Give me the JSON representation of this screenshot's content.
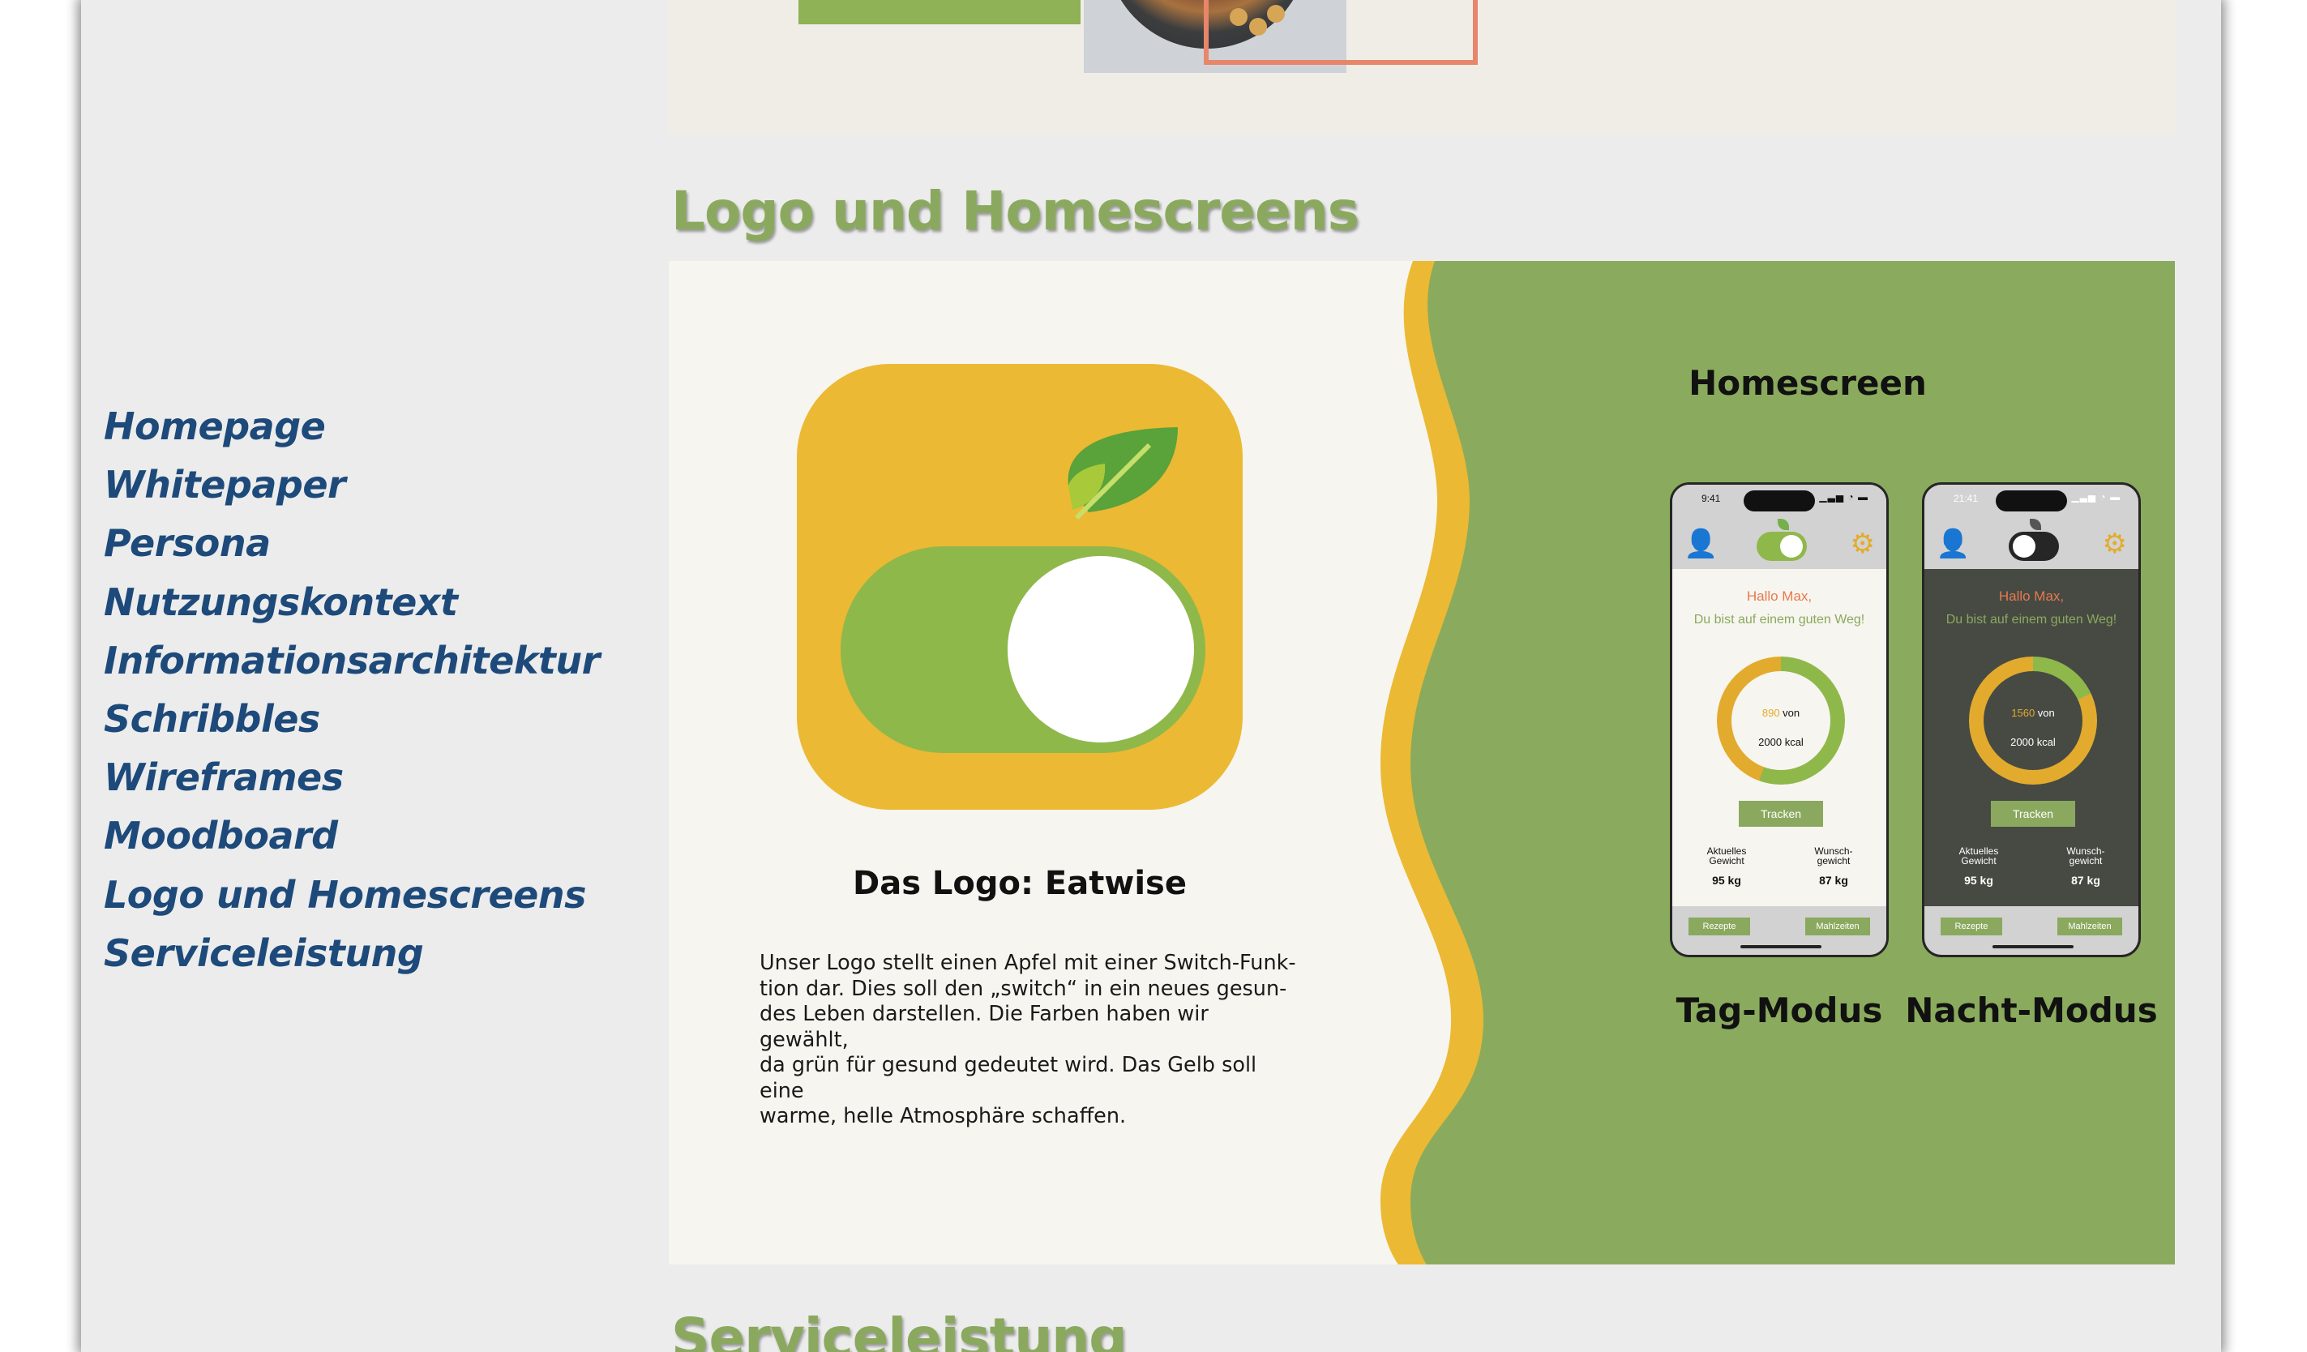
{
  "nav": {
    "items": [
      {
        "label": "Homepage"
      },
      {
        "label": "Whitepaper"
      },
      {
        "label": "Persona"
      },
      {
        "label": "Nutzungskontext"
      },
      {
        "label": "Informationsarchitektur"
      },
      {
        "label": "Schribbles"
      },
      {
        "label": "Wireframes"
      },
      {
        "label": "Moodboard"
      },
      {
        "label": "Logo und Homescreens"
      },
      {
        "label": "Serviceleistung"
      }
    ]
  },
  "section": {
    "title": "Logo und Homescreens",
    "logo_title": "Das Logo: Eatwise",
    "logo_text": [
      "Unser Logo stellt einen Apfel mit einer Switch-Funk-",
      "tion dar. Dies soll den „switch“ in ein neues gesun-",
      "des Leben darstellen. Die Farben haben wir gewählt,",
      "da grün für gesund gedeutet wird. Das Gelb soll eine",
      "warme, helle Atmosphäre schaffen."
    ],
    "homescreen_title": "Homescreen"
  },
  "phones": {
    "day": {
      "caption": "Tag-Modus",
      "time": "9:41",
      "status": "▁▃▅ ◔ ▬",
      "greeting": "Hallo Max,",
      "subgreeting": "Du bist auf einem guten Weg!",
      "kcal_current": "890",
      "kcal_von": " von",
      "kcal_goal": "2000 kcal",
      "track_label": "Tracken",
      "stat_left_label": [
        "Aktuelles",
        "Gewicht"
      ],
      "stat_left_value": "95 kg",
      "stat_right_label": [
        "Wunsch-",
        "gewicht"
      ],
      "stat_right_value": "87 kg",
      "tab_left": "Rezepte",
      "tab_right": "Mahlzeiten",
      "icon_profile": "👤",
      "icon_settings": "⚙"
    },
    "night": {
      "caption": "Nacht-Modus",
      "time": "21:41",
      "status": "▁▃▅ ◔ ▬",
      "greeting": "Hallo Max,",
      "subgreeting": "Du bist auf einem guten Weg!",
      "kcal_current": "1560",
      "kcal_von": " von",
      "kcal_goal": "2000 kcal",
      "track_label": "Tracken",
      "stat_left_label": [
        "Aktuelles",
        "Gewicht"
      ],
      "stat_left_value": "95 kg",
      "stat_right_label": [
        "Wunsch-",
        "gewicht"
      ],
      "stat_right_value": "87 kg",
      "tab_left": "Rezepte",
      "tab_right": "Mahlzeiten",
      "icon_profile": "👤",
      "icon_settings": "⚙"
    }
  },
  "next_section": {
    "title": "Serviceleistung"
  },
  "colors": {
    "nav_link": "#1d4a7a",
    "section_title": "#8aa95e",
    "green_panel": "#8aab5d",
    "yellow": "#ebb933",
    "logo_green": "#8fb84b",
    "accent_orange": "#e8794e"
  }
}
